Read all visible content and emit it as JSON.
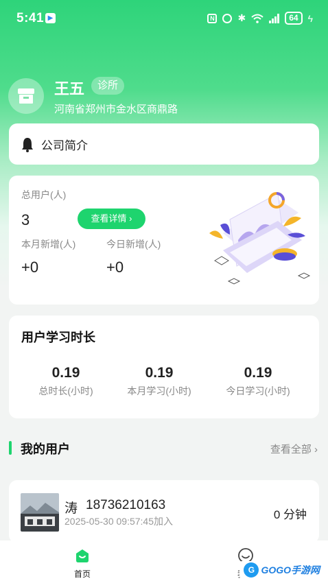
{
  "status_bar": {
    "time": "5:41",
    "battery": "64",
    "icons": [
      "app-notification-icon",
      "nfc-icon",
      "alarm-icon",
      "bluetooth-icon",
      "wifi-icon",
      "signal-icon",
      "battery-icon",
      "charging-icon"
    ]
  },
  "profile": {
    "name": "王五",
    "tag": "诊所",
    "address": "河南省郑州市金水区商鼎路",
    "icon": "store-icon"
  },
  "intro": {
    "label": "公司简介",
    "icon": "bell-icon"
  },
  "users_stats": {
    "total_label": "总用户(人)",
    "total_value": "3",
    "detail_button": "查看详情",
    "month_label": "本月新增(人)",
    "month_value": "+0",
    "today_label": "今日新增(人)",
    "today_value": "+0"
  },
  "study": {
    "title": "用户学习时长",
    "stats": [
      {
        "value": "0.19",
        "label": "总时长(小时)"
      },
      {
        "value": "0.19",
        "label": "本月学习(小时)"
      },
      {
        "value": "0.19",
        "label": "今日学习(小时)"
      }
    ]
  },
  "my_users": {
    "title": "我的用户",
    "view_all": "查看全部",
    "items": [
      {
        "name": "涛",
        "phone": "18736210163",
        "joined": "2025-05-30 09:57:45加入",
        "duration": "0 分钟"
      }
    ]
  },
  "tabs": [
    {
      "label": "首页",
      "icon": "home-icon",
      "active": true
    },
    {
      "label": "我的",
      "icon": "smiley-icon",
      "active": false
    }
  ],
  "watermark": {
    "text": "GOGO手游网"
  },
  "colors": {
    "accent": "#1ed46e",
    "header_gradient_top": "#2ed47a",
    "page_background": "#f2f4f3"
  }
}
